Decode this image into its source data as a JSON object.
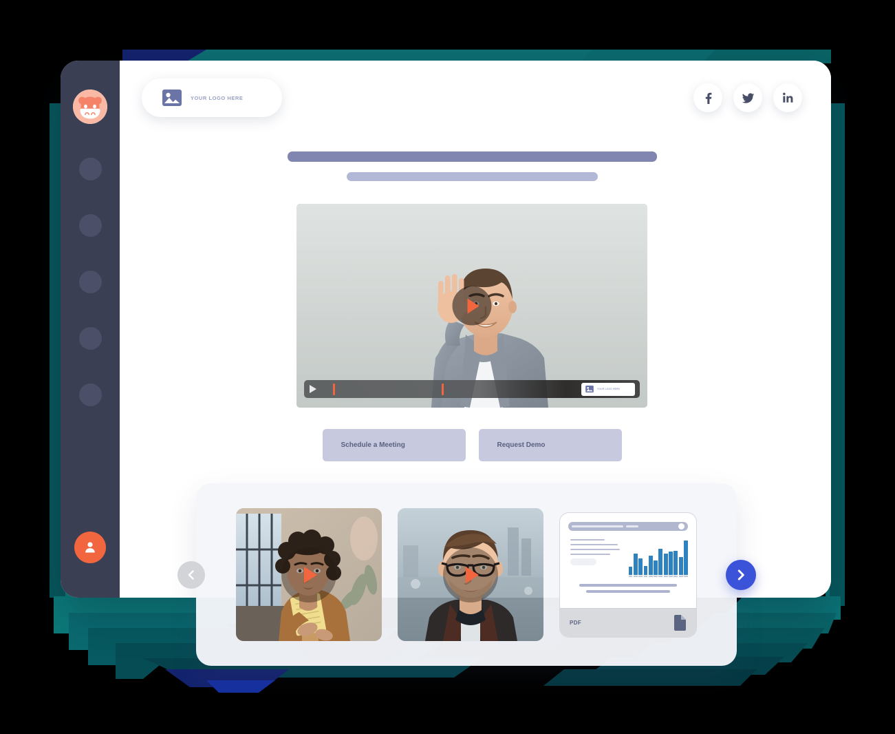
{
  "brand": {
    "avatar_icon": "hippo-mascot-icon",
    "avatar_colors": {
      "face": "#f6a68f",
      "mask": "#ffffff",
      "outline": "#f1663f"
    }
  },
  "sidebar": {
    "background": "#3b3f54",
    "nav_items": [
      {
        "name": "nav-placeholder-1",
        "label": ""
      },
      {
        "name": "nav-placeholder-2",
        "label": ""
      },
      {
        "name": "nav-placeholder-3",
        "label": ""
      },
      {
        "name": "nav-placeholder-4",
        "label": ""
      },
      {
        "name": "nav-placeholder-5",
        "label": ""
      }
    ],
    "user_button": {
      "icon": "user-icon",
      "color": "#f1663f"
    }
  },
  "header": {
    "logo": {
      "icon": "image-placeholder-icon",
      "text": "YOUR LOGO HERE"
    },
    "socials": [
      {
        "name": "facebook",
        "glyph": "f"
      },
      {
        "name": "twitter",
        "glyph": "twitter-bird"
      },
      {
        "name": "linkedin",
        "glyph": "in"
      }
    ]
  },
  "hero": {
    "title_placeholder": "",
    "subtitle_placeholder": "",
    "title_color": "#8086b0",
    "subtitle_color": "#b3b8d6"
  },
  "player": {
    "poster_alt": "Smiling man in grey blazer waving at camera",
    "play_button_icon": "play-icon",
    "accent": "#f1663f",
    "controls": {
      "play_icon": "play-icon",
      "markers": [
        {
          "name": "marker-start",
          "position_pct": 4
        },
        {
          "name": "marker-mid",
          "position_pct": 37
        }
      ],
      "badge": {
        "icon": "image-placeholder-icon",
        "text": "YOUR LOGO HERE"
      }
    }
  },
  "cta": {
    "buttons": [
      {
        "name": "schedule-meeting",
        "label": "Schedule a Meeting"
      },
      {
        "name": "request-demo",
        "label": "Request Demo"
      }
    ],
    "background": "#c7cadf",
    "text_color": "#5a6080"
  },
  "carousel": {
    "prev_label": "‹",
    "next_label": "›",
    "prev_color": "#d2d4d8",
    "next_color": "#3b53d8",
    "items": [
      {
        "name": "video-thumbnail-woman",
        "type": "video",
        "alt": "Woman with dark curly hair in tan jacket holding a yellow notebook",
        "play_icon": "play-icon"
      },
      {
        "name": "video-thumbnail-man",
        "type": "video",
        "alt": "Man with glasses and dark jacket on a blurred winter street",
        "play_icon": "play-icon"
      },
      {
        "name": "pdf-attachment-card",
        "type": "pdf",
        "label": "PDF",
        "file_icon": "document-icon"
      }
    ]
  },
  "chart_data": {
    "type": "bar",
    "title": "",
    "xlabel": "",
    "ylabel": "",
    "categories": [
      "Jan",
      "Feb",
      "Mar",
      "Apr",
      "May",
      "Jun",
      "Jul",
      "Aug",
      "Sep",
      "Oct",
      "Nov",
      "Dec"
    ],
    "values": [
      22,
      58,
      46,
      25,
      52,
      40,
      72,
      58,
      64,
      66,
      50,
      96
    ],
    "ylim": [
      0,
      100
    ],
    "grid": false,
    "legend": "none",
    "series_color": "#2f82c0"
  },
  "background": {
    "page": "#000000",
    "ribbon_teal": "#0c7a7a",
    "ribbon_teal_dark": "#06575c",
    "ribbon_navy": "#14236e",
    "ribbon_navy_dark": "#0b1440"
  }
}
